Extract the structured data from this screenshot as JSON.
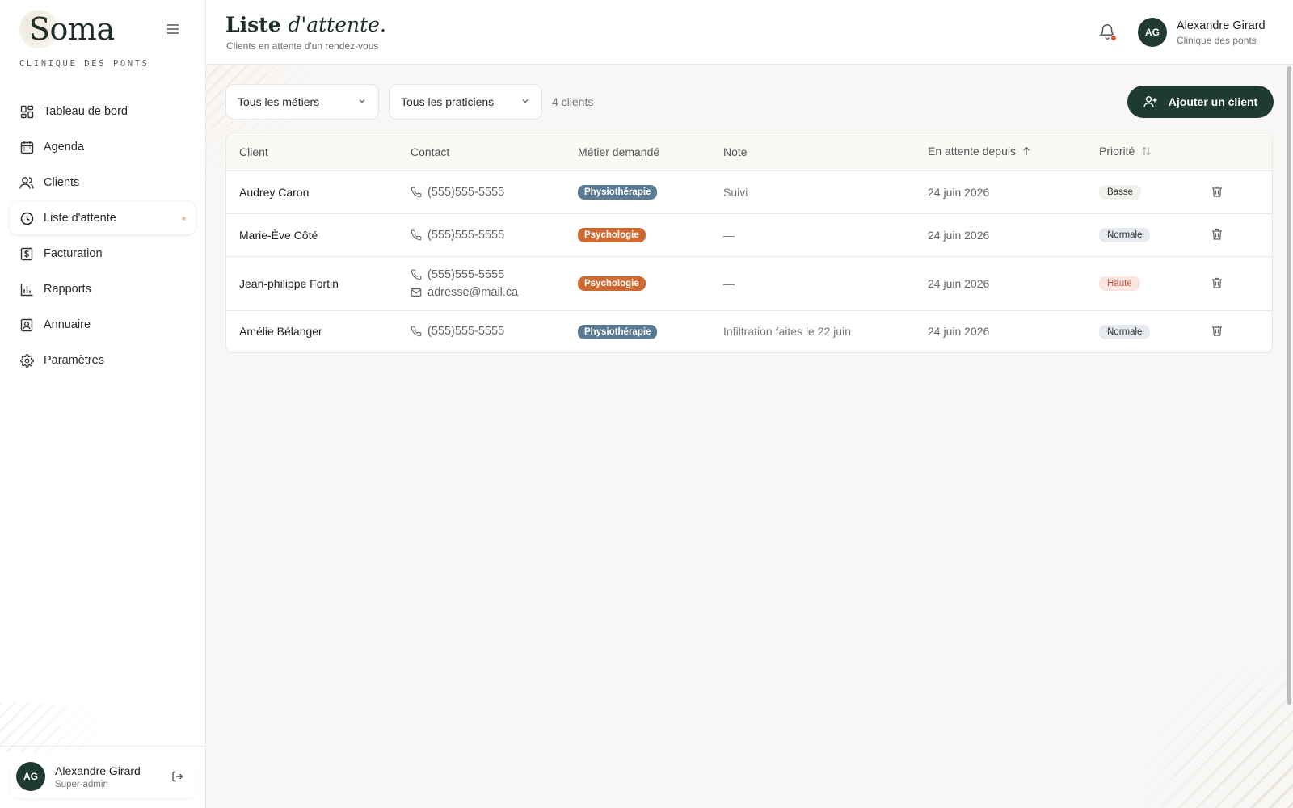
{
  "brand": {
    "name": "Soma",
    "subtitle": "CLINIQUE DES PONTS"
  },
  "sidebar": {
    "items": [
      {
        "label": "Tableau de bord",
        "icon": "dashboard-icon"
      },
      {
        "label": "Agenda",
        "icon": "calendar-icon"
      },
      {
        "label": "Clients",
        "icon": "users-icon"
      },
      {
        "label": "Liste d'attente",
        "icon": "clock-icon",
        "active": true
      },
      {
        "label": "Facturation",
        "icon": "invoice-icon"
      },
      {
        "label": "Rapports",
        "icon": "bar-chart-icon"
      },
      {
        "label": "Annuaire",
        "icon": "directory-icon"
      },
      {
        "label": "Paramètres",
        "icon": "gear-icon"
      }
    ],
    "user": {
      "initials": "AG",
      "name": "Alexandre Girard",
      "role": "Super-admin"
    }
  },
  "header": {
    "title_main": "Liste",
    "title_em": "d'attente.",
    "subtitle": "Clients en attente d'un rendez-vous",
    "user": {
      "initials": "AG",
      "name": "Alexandre Girard",
      "clinic": "Clinique des ponts"
    }
  },
  "filters": {
    "trade": "Tous les métiers",
    "practitioner": "Tous les praticiens",
    "count": "4 clients",
    "add_button": "Ajouter un client"
  },
  "table": {
    "columns": [
      "Client",
      "Contact",
      "Métier demandé",
      "Note",
      "En attente depuis",
      "Priorité"
    ],
    "rows": [
      {
        "client": "Audrey Caron",
        "phone": "(555)555-5555",
        "email": "",
        "trade": "Physiothérapie",
        "trade_kind": "physio",
        "note": "Suivi",
        "since": "24 juin 2026",
        "priority": "Basse",
        "priority_kind": "basse"
      },
      {
        "client": "Marie-Ève Côté",
        "phone": "(555)555-5555",
        "email": "",
        "trade": "Psychologie",
        "trade_kind": "psycho",
        "note": "—",
        "since": "24 juin 2026",
        "priority": "Normale",
        "priority_kind": "normale"
      },
      {
        "client": "Jean-philippe Fortin",
        "phone": "(555)555-5555",
        "email": "adresse@mail.ca",
        "trade": "Psychologie",
        "trade_kind": "psycho",
        "note": "—",
        "since": "24 juin 2026",
        "priority": "Haute",
        "priority_kind": "haute"
      },
      {
        "client": "Amélie Bélanger",
        "phone": "(555)555-5555",
        "email": "",
        "trade": "Physiothérapie",
        "trade_kind": "physio",
        "note": "Infiltration faites le 22 juin",
        "since": "24 juin 2026",
        "priority": "Normale",
        "priority_kind": "normale"
      }
    ]
  },
  "colors": {
    "brand_dark": "#1f3a30",
    "physio": "#5b7a93",
    "psycho": "#cf6a32",
    "alert": "#d9533f"
  }
}
